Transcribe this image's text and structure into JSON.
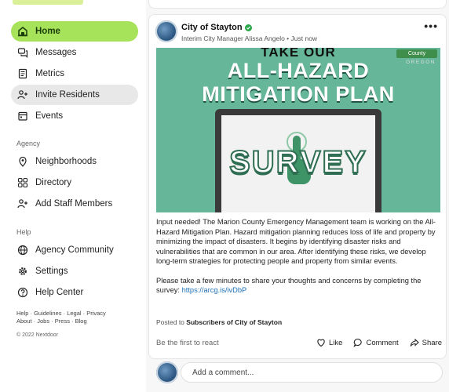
{
  "sidebar": {
    "nav": [
      {
        "label": "Home",
        "icon": "home-icon"
      },
      {
        "label": "Messages",
        "icon": "chat-bubbles-icon"
      },
      {
        "label": "Metrics",
        "icon": "document-icon"
      },
      {
        "label": "Invite Residents",
        "icon": "people-plus-icon"
      },
      {
        "label": "Events",
        "icon": "calendar-icon"
      }
    ],
    "agency_label": "Agency",
    "agency_nav": [
      {
        "label": "Neighborhoods",
        "icon": "location-pin-icon"
      },
      {
        "label": "Directory",
        "icon": "grid-icon"
      },
      {
        "label": "Add Staff Members",
        "icon": "people-plus-icon"
      }
    ],
    "help_label": "Help",
    "help_nav": [
      {
        "label": "Agency Community",
        "icon": "globe-icon"
      },
      {
        "label": "Settings",
        "icon": "gear-icon"
      },
      {
        "label": "Help Center",
        "icon": "question-icon"
      }
    ],
    "footer_line1": "Help · Guidelines · Legal · Privacy",
    "footer_line2": "About · Jobs · Press · Blog",
    "copyright": "© 2022 Nextdoor"
  },
  "post": {
    "author": "City of Stayton",
    "subline": "Interim City Manager Alissa Angelo • Just now",
    "more": "•••",
    "image": {
      "top_text": "TAKE OUR",
      "title_line1": "ALL-HAZARD",
      "title_line2": "MITIGATION PLAN",
      "screen_text": "SURVEY",
      "badge_text": "County",
      "badge_sub": "OREGON"
    },
    "body_p1": "Input needed! The Marion County Emergency Management team is working on the All-Hazard Mitigation Plan. Hazard mitigation planning reduces loss of life and property by minimizing the impact of disasters. It begins by identifying disaster risks and vulnerabilities that are common in our area. After identifying these risks, we develop long-term strategies for protecting people and property from similar events.",
    "body_p2": "Please take a few minutes to share your thoughts and concerns by completing the survey:",
    "link": "https://arcg.is/ivDbP",
    "posted_prefix": "Posted to",
    "posted_to": "Subscribers of City of Stayton",
    "first_react": "Be the first to react",
    "like": "Like",
    "comment": "Comment",
    "share": "Share"
  },
  "comment_box": {
    "placeholder": "Add a comment..."
  },
  "colors": {
    "accent": "#a6e25a",
    "hero_bg": "#66b79a",
    "link": "#1b6fb6",
    "verified": "#2aa84a"
  }
}
